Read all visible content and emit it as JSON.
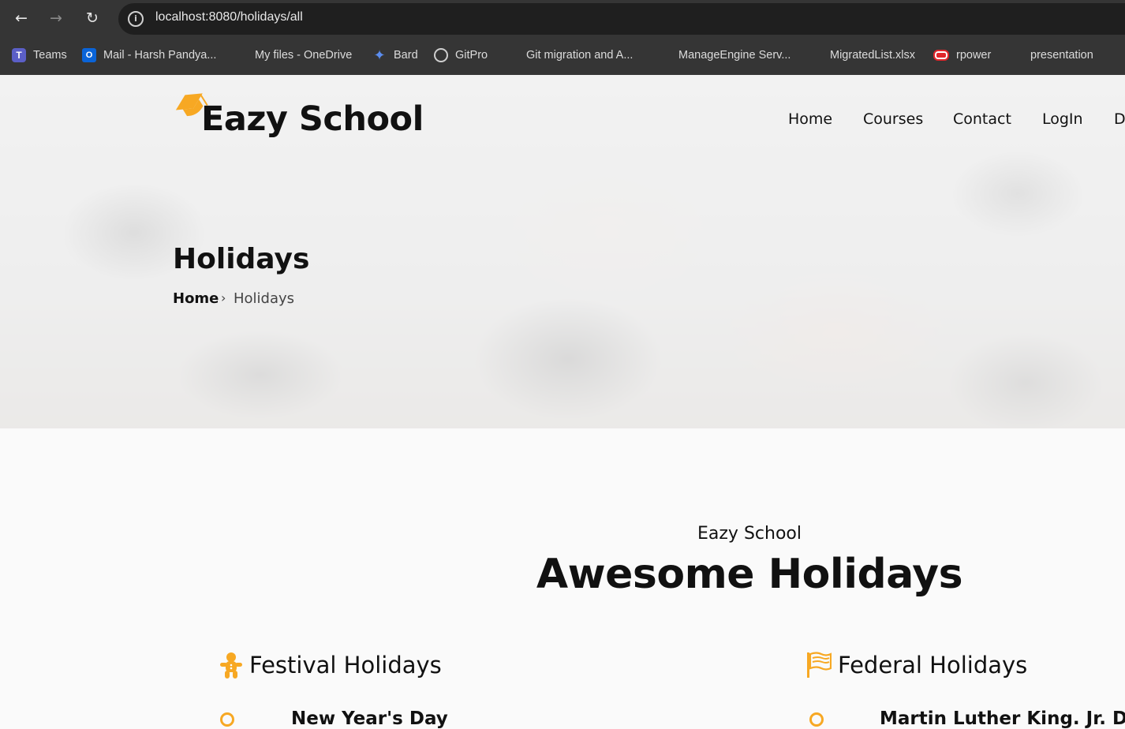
{
  "browser": {
    "url": "localhost:8080/holidays/all",
    "bookmarks": [
      {
        "label": "Teams",
        "icon": "teams-icon"
      },
      {
        "label": "Mail - Harsh Pandya...",
        "icon": "outlook-icon"
      },
      {
        "label": "My files - OneDrive",
        "icon": "microsoft-icon"
      },
      {
        "label": "Bard",
        "icon": "bard-sparkle-icon"
      },
      {
        "label": "GitPro",
        "icon": "globe-icon"
      },
      {
        "label": "Git migration and A...",
        "icon": "microsoft-icon"
      },
      {
        "label": "ManageEngine Serv...",
        "icon": "microsoft-icon"
      },
      {
        "label": "MigratedList.xlsx",
        "icon": "microsoft-icon"
      },
      {
        "label": "rpower",
        "icon": "oracle-icon"
      },
      {
        "label": "presentation",
        "icon": "microsoft-icon"
      }
    ]
  },
  "header": {
    "brand": "Eazy School",
    "nav": [
      "Home",
      "Courses",
      "Contact",
      "LogIn",
      "D"
    ]
  },
  "hero": {
    "title": "Holidays",
    "breadcrumb": {
      "home": "Home",
      "separator": "›",
      "current": "Holidays"
    }
  },
  "section": {
    "subtitle": "Eazy School",
    "title": "Awesome Holidays",
    "columns": [
      {
        "heading": "Festival Holidays",
        "icon": "gingerbread-icon",
        "first_item": "New Year's Day"
      },
      {
        "heading": "Federal Holidays",
        "icon": "flag-icon",
        "first_item": "Martin Luther King. Jr. Da"
      }
    ]
  },
  "colors": {
    "accent": "#f7a823",
    "chrome": "#353535",
    "text": "#111111"
  }
}
